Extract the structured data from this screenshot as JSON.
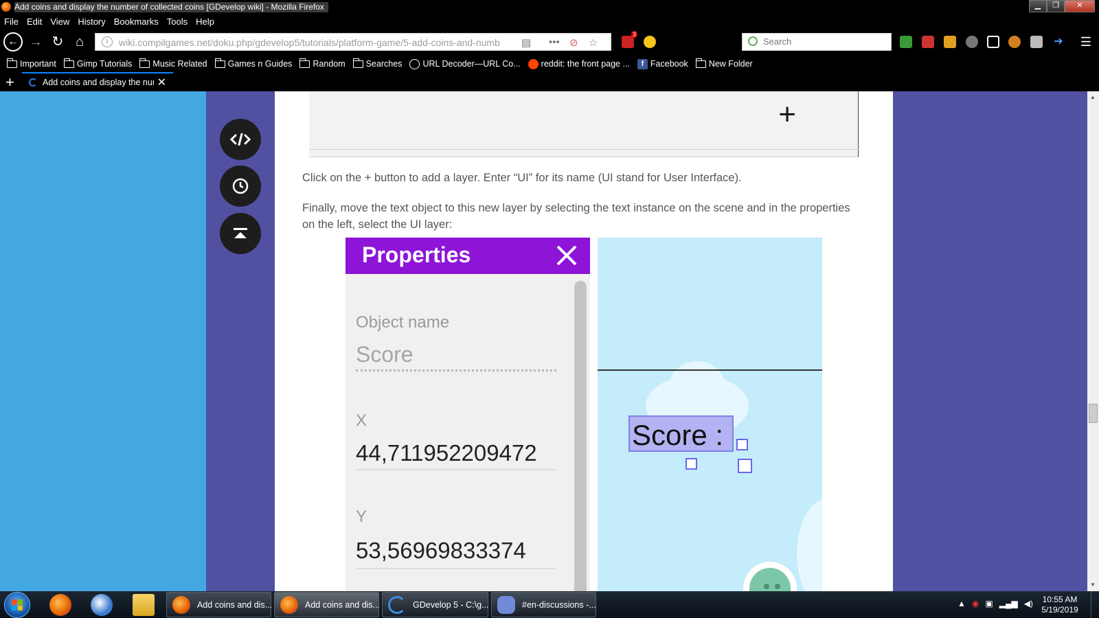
{
  "window": {
    "title": "Add coins and display the number of collected coins [GDevelop wiki] - Mozilla Firefox",
    "controls": [
      "minimize",
      "restore",
      "close"
    ]
  },
  "menubar": [
    "File",
    "Edit",
    "View",
    "History",
    "Bookmarks",
    "Tools",
    "Help"
  ],
  "navbar": {
    "url": "wiki.compilgames.net/doku.php/gdevelop5/tutorials/platform-game/5-add-coins-and-numb",
    "search_placeholder": "Search",
    "addon_badge": "3"
  },
  "bookmarks": [
    {
      "label": "Important",
      "icon": "folder-icon"
    },
    {
      "label": "Gimp Tutorials",
      "icon": "folder-icon"
    },
    {
      "label": "Music Related",
      "icon": "folder-icon"
    },
    {
      "label": "Games n Guides",
      "icon": "folder-icon"
    },
    {
      "label": "Random",
      "icon": "folder-icon"
    },
    {
      "label": "Searches",
      "icon": "folder-icon"
    },
    {
      "label": "URL Decoder—URL Co...",
      "icon": "globe-icon"
    },
    {
      "label": "reddit: the front page ...",
      "icon": "reddit-icon"
    },
    {
      "label": "Facebook",
      "icon": "facebook-icon"
    },
    {
      "label": "New Folder",
      "icon": "folder-icon"
    }
  ],
  "tab": {
    "title": "Add coins and display the num",
    "new_tab_icon": "plus-icon",
    "close_icon": "close-icon"
  },
  "page": {
    "side_buttons": [
      "code-icon",
      "clock-icon",
      "back-to-top-icon"
    ],
    "layers_panel_icon": "plus-icon",
    "paragraph1": "Click on the + button to add a layer. Enter “UI” for its name (UI stand for User Interface).",
    "paragraph2": "Finally, move the text object to this new layer by selecting the text instance on the scene and in the properties on the left, select the UI layer:"
  },
  "properties_panel": {
    "title": "Properties",
    "object_name_label": "Object name",
    "object_name_value": "Score",
    "x_label": "X",
    "x_value": "44,711952209472",
    "y_label": "Y",
    "y_value": "53,56969833374"
  },
  "scene": {
    "score_text": "Score :"
  },
  "taskbar": {
    "pinned": [
      "firefox-icon",
      "thunderbird-icon",
      "file-explorer-icon"
    ],
    "tasks": [
      {
        "label": "Add coins and dis...",
        "icon": "firefox-icon"
      },
      {
        "label": "Add coins and dis...",
        "icon": "firefox-icon"
      },
      {
        "label": "GDevelop 5 - C:\\g...",
        "icon": "gdevelop-icon"
      },
      {
        "label": "#en-discussions -...",
        "icon": "discord-icon"
      }
    ],
    "time": "10:55 AM",
    "date": "5/19/2019"
  },
  "colors": {
    "page_left_bg": "#43a7e2",
    "page_side_purple": "#5150a1",
    "properties_header": "#8e14d8",
    "scene_sky": "#c4ecfb",
    "selection_fill": "#b3b3f3"
  }
}
